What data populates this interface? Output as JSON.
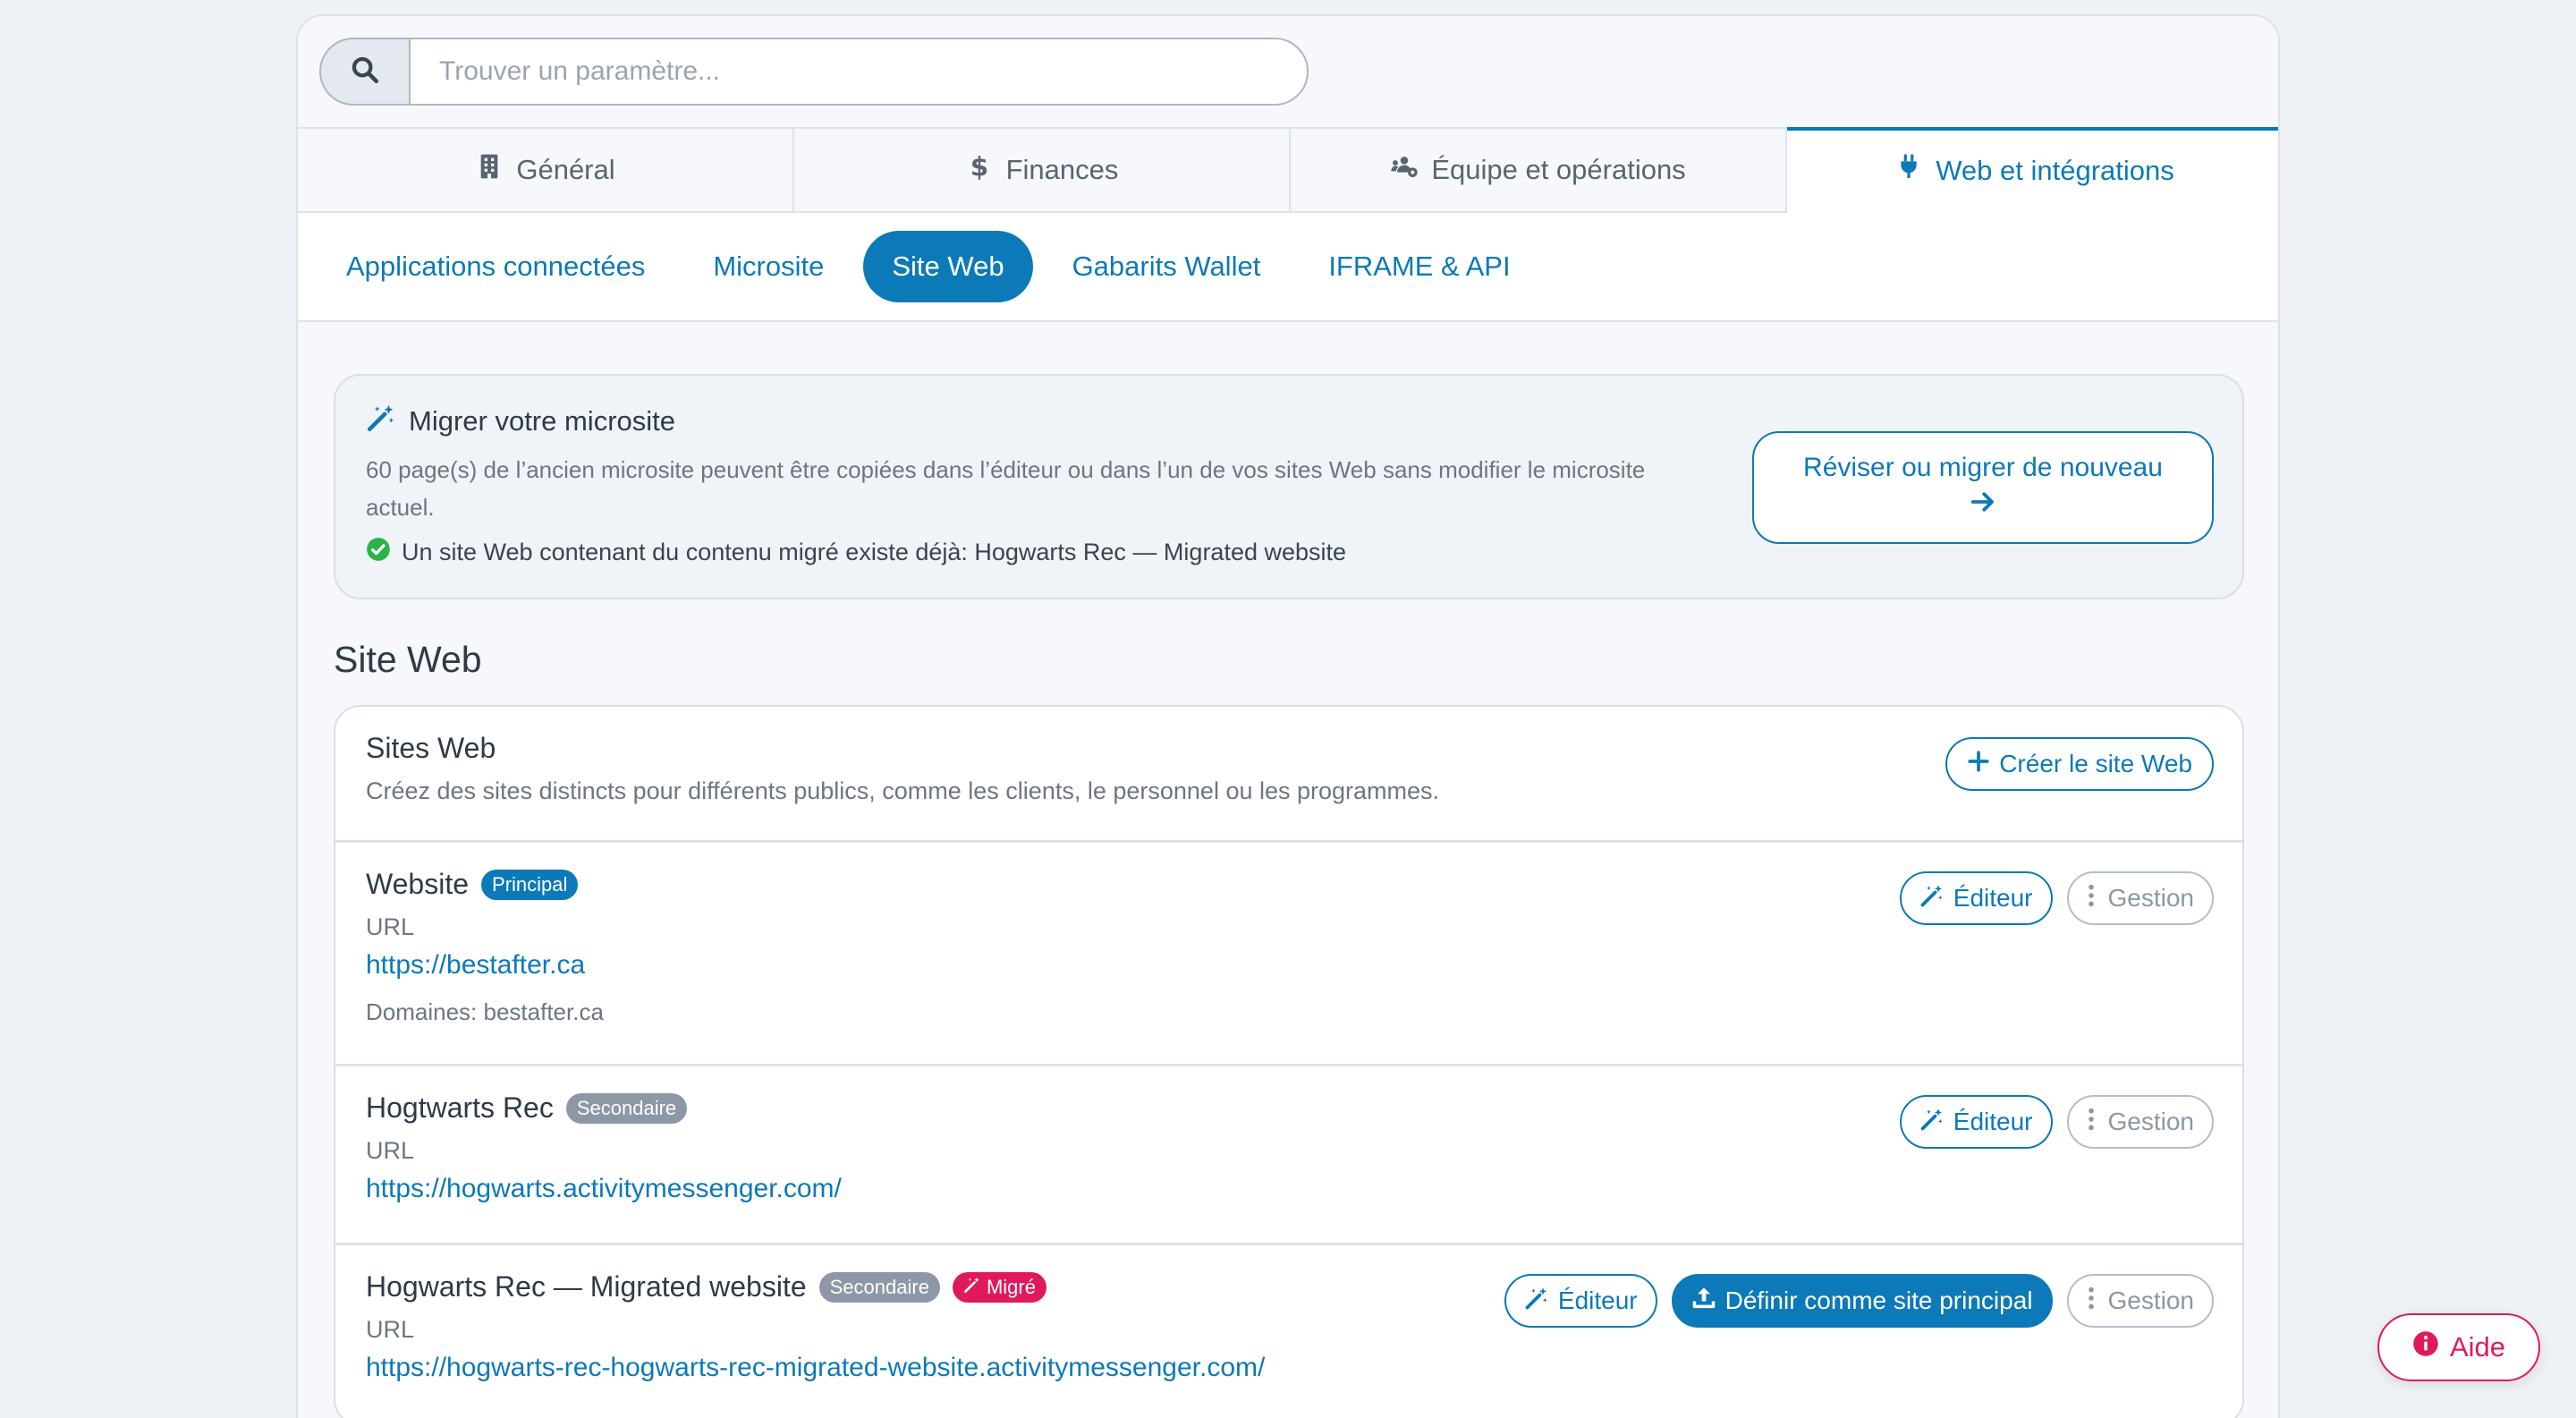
{
  "search": {
    "placeholder": "Trouver un paramètre..."
  },
  "main_tabs": [
    {
      "label": "Général",
      "icon": "building-icon"
    },
    {
      "label": "Finances",
      "icon": "dollar-icon"
    },
    {
      "label": "Équipe et opérations",
      "icon": "users-gear-icon"
    },
    {
      "label": "Web et intégrations",
      "icon": "plug-icon",
      "active": true
    }
  ],
  "sub_tabs": [
    {
      "label": "Applications connectées"
    },
    {
      "label": "Microsite"
    },
    {
      "label": "Site Web",
      "active": true
    },
    {
      "label": "Gabarits Wallet"
    },
    {
      "label": "IFRAME & API"
    }
  ],
  "migrate": {
    "title": "Migrer votre microsite",
    "description": "60 page(s) de l’ancien microsite peuvent être copiées dans l’éditeur ou dans l’un de vos sites Web sans modifier le microsite actuel.",
    "status": "Un site Web contenant du contenu migré existe déjà: Hogwarts Rec — Migrated website",
    "button_label": "Réviser ou migrer de nouveau"
  },
  "section_title": "Site Web",
  "sites": {
    "title": "Sites Web",
    "description": "Créez des sites distincts pour différents publics, comme les clients, le personnel ou les programmes.",
    "create_label": "Créer le site Web",
    "url_label": "URL",
    "editor_label": "Éditeur",
    "manage_label": "Gestion",
    "set_primary_label": "Définir comme site principal",
    "items": [
      {
        "name": "Website",
        "badge": "Principal",
        "url": "https://bestafter.ca",
        "domains": "Domaines: bestafter.ca"
      },
      {
        "name": "Hogtwarts Rec",
        "badge": "Secondaire",
        "url": "https://hogwarts.activitymessenger.com/"
      },
      {
        "name": "Hogwarts Rec — Migrated website",
        "badge": "Secondaire",
        "badge2": "Migré",
        "url": "https://hogwarts-rec-hogwarts-rec-migrated-website.activitymessenger.com/"
      }
    ]
  },
  "help": {
    "label": "Aide"
  },
  "colors": {
    "accent": "#0c79b8",
    "danger": "#e0195b",
    "success": "#2bb34a",
    "badge_secondary": "#8d97a6"
  }
}
